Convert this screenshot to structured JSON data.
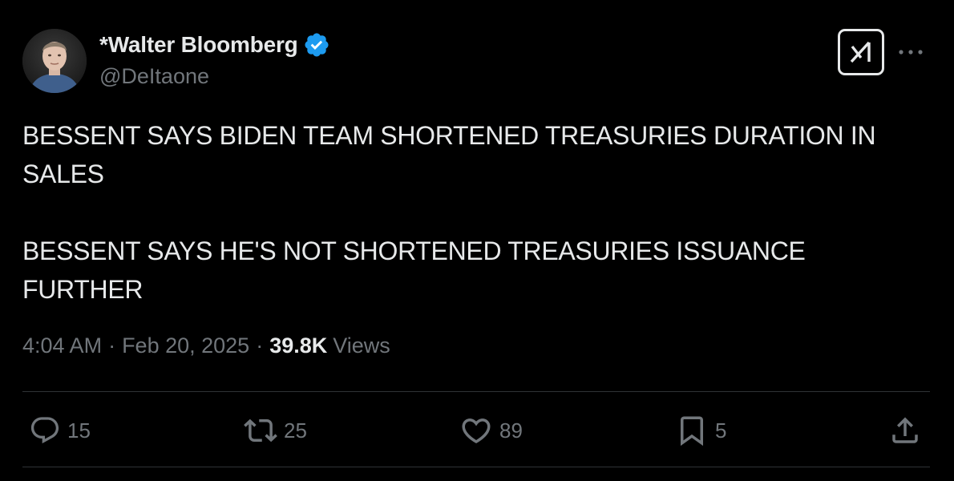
{
  "author": {
    "display_name": "*Walter Bloomberg",
    "handle": "@DeItaone",
    "verified": true,
    "verified_color": "#1d9bf0"
  },
  "tweet": {
    "paragraphs": [
      "BESSENT SAYS BIDEN TEAM SHORTENED TREASURIES DURATION IN\nSALES",
      "BESSENT SAYS HE'S NOT SHORTENED TREASURIES ISSUANCE\nFURTHER"
    ]
  },
  "meta": {
    "time": "4:04 AM",
    "separator": "·",
    "date": "Feb 20, 2025",
    "views_count": "39.8K",
    "views_label": "Views"
  },
  "actions": {
    "replies": {
      "icon": "reply-icon",
      "count": "15"
    },
    "reposts": {
      "icon": "repost-icon",
      "count": "25"
    },
    "likes": {
      "icon": "like-icon",
      "count": "89"
    },
    "bookmarks": {
      "icon": "bookmark-icon",
      "count": "5"
    },
    "share": {
      "icon": "share-icon"
    }
  },
  "header_icons": {
    "grok": "grok-icon",
    "more": "more-icon"
  },
  "colors": {
    "background": "#000000",
    "text_primary": "#e7e9ea",
    "text_secondary": "#71767b",
    "divider": "#2f3336",
    "accent": "#1d9bf0"
  }
}
